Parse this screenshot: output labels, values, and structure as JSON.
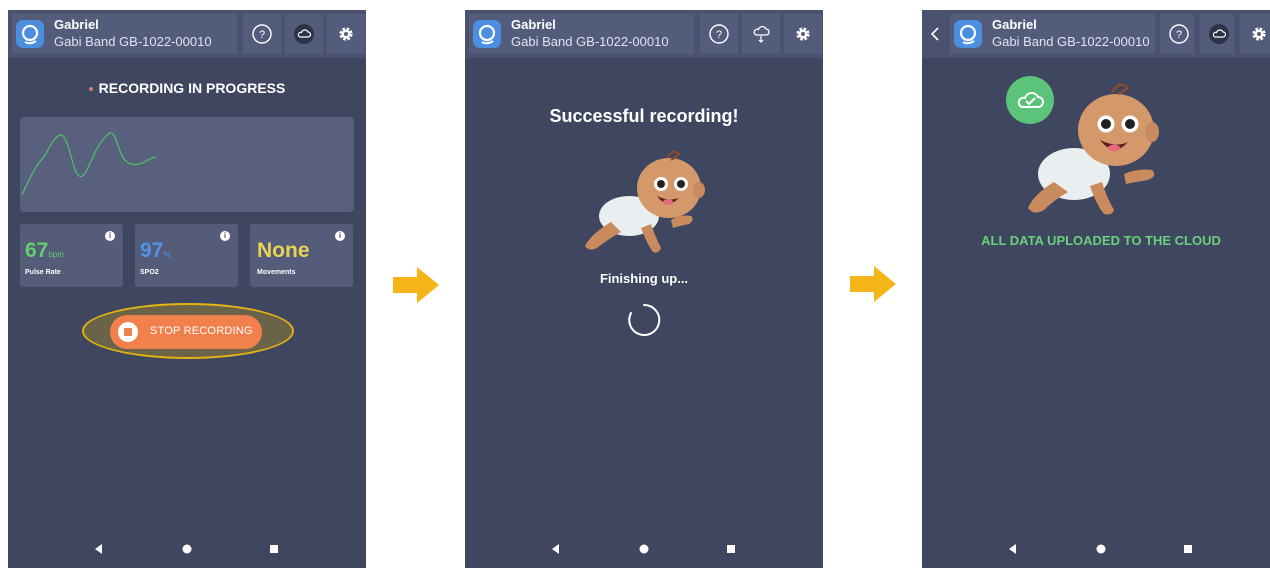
{
  "header": {
    "user_name": "Gabriel",
    "device_name": "Gabi Band GB-1022-00010",
    "icons": [
      "logo-icon",
      "help-icon",
      "cloud-icon",
      "settings-icon"
    ]
  },
  "screen1": {
    "status": "RECORDING IN PROGRESS",
    "pulse": {
      "value": "67",
      "unit": "bpm",
      "label": "Pulse Rate",
      "color": "#62d06e"
    },
    "spo2": {
      "value": "97",
      "unit": "%",
      "label": "SPO2",
      "color": "#4f93ea"
    },
    "movements": {
      "value": "None",
      "label": "Movements",
      "color": "#e7d452"
    },
    "stop_button": "STOP RECORDING",
    "highlight_color": "#e3b213"
  },
  "screen2": {
    "title": "Successful recording!",
    "status": "Finishing up..."
  },
  "screen3": {
    "status": "ALL DATA UPLOADED TO THE CLOUD",
    "success_color": "#6bd07a"
  },
  "nav_icons": [
    "back-triangle-icon",
    "home-circle-icon",
    "recents-square-icon"
  ],
  "colors": {
    "screen_bg": "#3f4660",
    "arrow": "#f5b417",
    "button": "#f1804d"
  }
}
